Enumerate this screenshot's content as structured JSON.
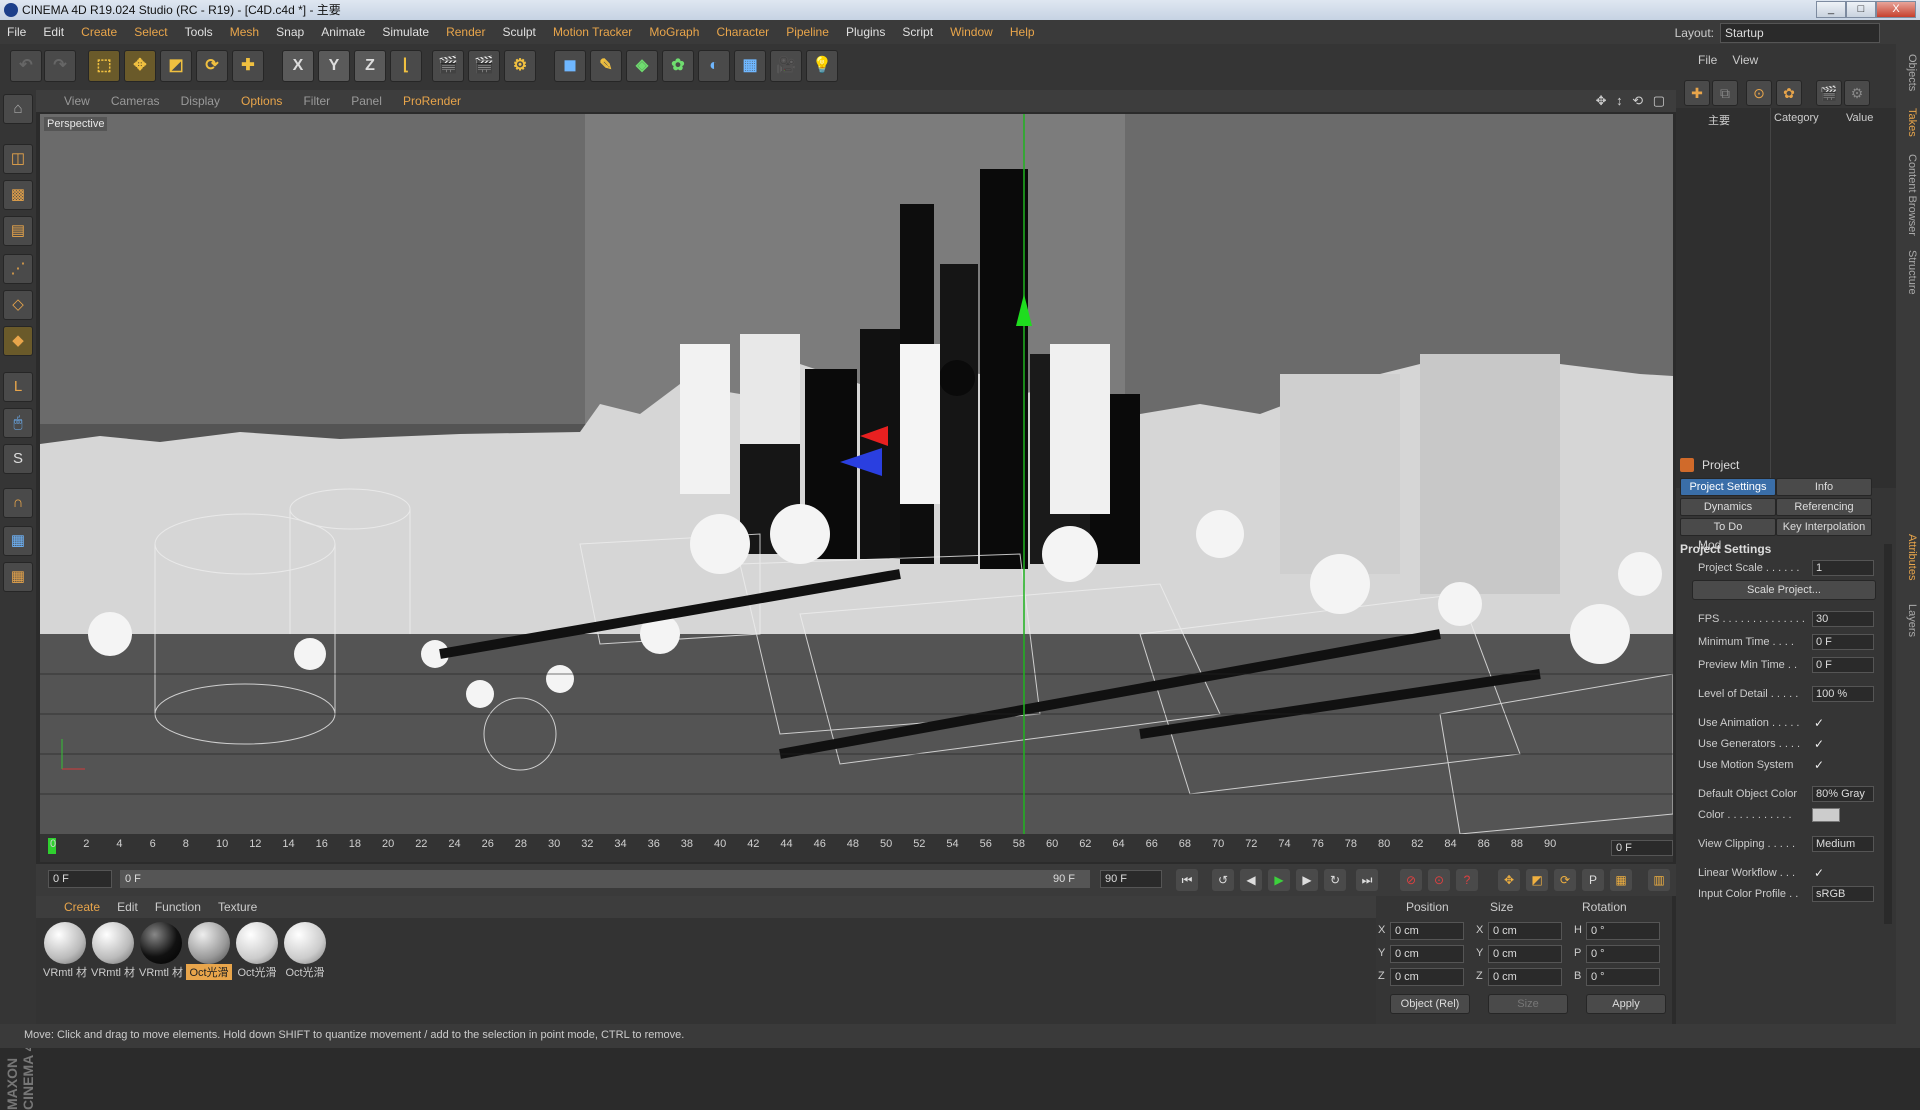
{
  "window": {
    "title": "CINEMA 4D R19.024 Studio (RC - R19) - [C4D.c4d *] - 主要",
    "min": "_",
    "max": "□",
    "close": "X"
  },
  "menu": {
    "items": [
      "File",
      "Edit",
      "Create",
      "Select",
      "Tools",
      "Mesh",
      "Snap",
      "Animate",
      "Simulate",
      "Render",
      "Sculpt",
      "Motion Tracker",
      "MoGraph",
      "Character",
      "Pipeline",
      "Plugins",
      "Script",
      "Window",
      "Help"
    ],
    "layout_label": "Layout:",
    "layout_value": "Startup"
  },
  "toolbar": {
    "x": "X",
    "y": "Y",
    "z": "Z"
  },
  "viewport": {
    "menu": [
      "View",
      "Cameras",
      "Display",
      "Options",
      "Filter",
      "Panel",
      "ProRender"
    ],
    "active_menu": "Options",
    "label": "Perspective",
    "nav_icons": "✥ ↕ ⟲ ▢"
  },
  "timeline": {
    "ticks": [
      "0",
      "2",
      "4",
      "6",
      "8",
      "10",
      "12",
      "14",
      "16",
      "18",
      "20",
      "22",
      "24",
      "26",
      "28",
      "30",
      "32",
      "34",
      "36",
      "38",
      "40",
      "42",
      "44",
      "46",
      "48",
      "50",
      "52",
      "54",
      "56",
      "58",
      "60",
      "62",
      "64",
      "66",
      "68",
      "70",
      "72",
      "74",
      "76",
      "78",
      "80",
      "82",
      "84",
      "86",
      "88",
      "90"
    ],
    "current": "0 F"
  },
  "transport": {
    "start": "0 F",
    "range_start": "0 F",
    "range_end": "90 F",
    "end": "90 F"
  },
  "materials": {
    "tabs": [
      "Create",
      "Edit",
      "Function",
      "Texture"
    ],
    "active_tab": "Create",
    "items": [
      {
        "label": "VRmtl 材",
        "color": "#e8e8e8"
      },
      {
        "label": "VRmtl 材",
        "color": "#e8e8e8"
      },
      {
        "label": "VRmtl 材",
        "color": "#1a1a1a"
      },
      {
        "label": "Oct光滑",
        "color": "#bdbdbd"
      },
      {
        "label": "Oct光滑",
        "color": "#e0e0e0"
      },
      {
        "label": "Oct光滑",
        "color": "#e0e0e0"
      }
    ]
  },
  "coords": {
    "headers": {
      "position": "Position",
      "size": "Size",
      "rotation": "Rotation"
    },
    "rows": [
      {
        "a": "X",
        "pos": "0 cm",
        "b": "X",
        "size": "0 cm",
        "c": "H",
        "rot": "0 °"
      },
      {
        "a": "Y",
        "pos": "0 cm",
        "b": "Y",
        "size": "0 cm",
        "c": "P",
        "rot": "0 °"
      },
      {
        "a": "Z",
        "pos": "0 cm",
        "b": "Z",
        "size": "0 cm",
        "c": "B",
        "rot": "0 °"
      }
    ],
    "mode": "Object (Rel)",
    "size_mode": "Size",
    "apply": "Apply"
  },
  "status": "Move: Click and drag to move elements. Hold down SHIFT to quantize movement / add to the selection in point mode, CTRL to remove.",
  "objects": {
    "menu": [
      "File",
      "View"
    ],
    "columns": {
      "name": "主要",
      "category": "Category",
      "value": "Value"
    }
  },
  "attributes": {
    "mode": "Mod",
    "title": "Project",
    "tabs": [
      "Project Settings",
      "Info",
      "Dynamics",
      "Referencing",
      "To Do",
      "Key Interpolation"
    ],
    "section": "Project Settings",
    "rows": [
      {
        "label": "Project Scale . . . . . .",
        "value": "1"
      },
      {
        "label": "FPS . . . . . . . . . . . . . .",
        "value": "30"
      },
      {
        "label": "Minimum Time . . . .",
        "value": "0 F"
      },
      {
        "label": "Preview Min Time . .",
        "value": "0 F"
      },
      {
        "label": "Level of Detail . . . . .",
        "value": "100 %"
      },
      {
        "label": "Use Animation . . . . .",
        "value": "✓"
      },
      {
        "label": "Use Generators . . . .",
        "value": "✓"
      },
      {
        "label": "Use Motion System",
        "value": "✓"
      },
      {
        "label": "Default Object Color",
        "value": "80% Gray"
      },
      {
        "label": "Color . . . . . . . . . . .",
        "value": ""
      },
      {
        "label": "View Clipping . . . . .",
        "value": "Medium"
      },
      {
        "label": "Linear Workflow . . .",
        "value": "✓"
      },
      {
        "label": "Input Color Profile . .",
        "value": "sRGB"
      }
    ],
    "scale_button": "Scale Project..."
  },
  "side_tabs": [
    "Objects",
    "Takes",
    "Content Browser",
    "Structure",
    "Attributes",
    "Layers"
  ],
  "logo": "MAXON CINEMA 4D"
}
